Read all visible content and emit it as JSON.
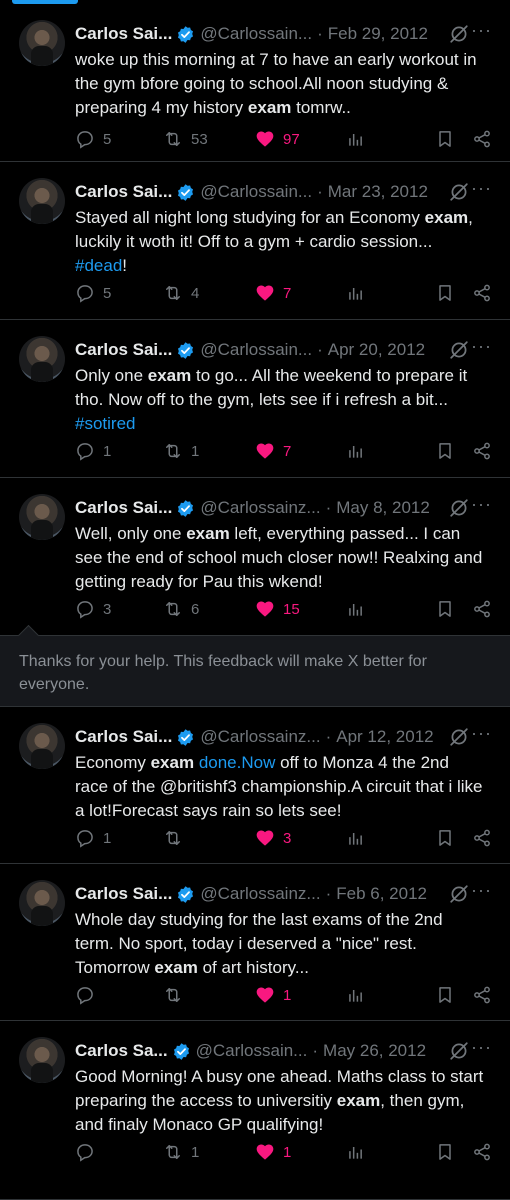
{
  "colors": {
    "accent": "#1d9bf0",
    "like": "#f91880",
    "muted": "#71767b",
    "background": "#000000"
  },
  "tweets": [
    {
      "name": "Carlos Sai...",
      "handle": "@Carlossain...",
      "date": "Feb 29, 2012",
      "text": [
        {
          "t": "woke up this morning at 7 to have an early workout in the gym bfore going to school.All noon studying & preparing  4 my history "
        },
        {
          "t": "exam",
          "s": "b"
        },
        {
          "t": " tomrw.."
        }
      ],
      "replies": "5",
      "retweets": "53",
      "likes": "97",
      "liked": true
    },
    {
      "name": "Carlos Sai...",
      "handle": "@Carlossain...",
      "date": "Mar 23, 2012",
      "text": [
        {
          "t": "Stayed all night long studying for an Economy "
        },
        {
          "t": "exam",
          "s": "b"
        },
        {
          "t": ", luckily it woth it! Off to a gym + cardio session... "
        },
        {
          "t": "#dead",
          "s": "link"
        },
        {
          "t": "!"
        }
      ],
      "replies": "5",
      "retweets": "4",
      "likes": "7",
      "liked": true
    },
    {
      "name": "Carlos Sai...",
      "handle": "@Carlossain...",
      "date": "Apr 20, 2012",
      "text": [
        {
          "t": "Only one "
        },
        {
          "t": "exam",
          "s": "b"
        },
        {
          "t": " to go... All the weekend to prepare it tho. Now off to the gym, lets see if i refresh a bit... "
        },
        {
          "t": "#sotired",
          "s": "link"
        }
      ],
      "replies": "1",
      "retweets": "1",
      "likes": "7",
      "liked": true
    },
    {
      "name": "Carlos Sai...",
      "handle": "@Carlossainz...",
      "date": "May 8, 2012",
      "text": [
        {
          "t": "Well, only one "
        },
        {
          "t": "exam",
          "s": "b"
        },
        {
          "t": " left, everything passed... I can see the end of school much closer now!! Realxing and getting ready for Pau this wkend!"
        }
      ],
      "replies": "3",
      "retweets": "6",
      "likes": "15",
      "liked": true
    },
    {
      "name": "Carlos Sai...",
      "handle": "@Carlossainz...",
      "date": "Apr 12, 2012",
      "text": [
        {
          "t": "Economy "
        },
        {
          "t": "exam",
          "s": "b"
        },
        {
          "t": " "
        },
        {
          "t": "done.Now",
          "s": "link"
        },
        {
          "t": " off to Monza 4 the 2nd race of the @britishf3 championship.A circuit that i like a lot!Forecast says rain so lets see!"
        }
      ],
      "replies": "1",
      "retweets": "",
      "likes": "3",
      "liked": true
    },
    {
      "name": "Carlos Sai...",
      "handle": "@Carlossainz...",
      "date": "Feb 6, 2012",
      "text": [
        {
          "t": "Whole day studying for the last exams of the 2nd term. No sport, today i deserved a \"nice\" rest. Tomorrow "
        },
        {
          "t": "exam",
          "s": "b"
        },
        {
          "t": " of art history..."
        }
      ],
      "replies": "",
      "retweets": "",
      "likes": "1",
      "liked": true
    },
    {
      "name": "Carlos Sa...",
      "handle": "@Carlossain...",
      "date": "May 26, 2012",
      "text": [
        {
          "t": "Good Morning! A busy one ahead. Maths class to start preparing the access to universitiy "
        },
        {
          "t": "exam",
          "s": "b"
        },
        {
          "t": ", then gym, and finaly Monaco GP qualifying!"
        }
      ],
      "replies": "",
      "retweets": "1",
      "likes": "1",
      "liked": true
    }
  ],
  "feedback": {
    "message": "Thanks for your help. This feedback will make X better for everyone."
  },
  "icons": {
    "reply": "reply-icon",
    "retweet": "retweet-icon",
    "like": "heart-icon",
    "views": "analytics-icon",
    "bookmark": "bookmark-icon",
    "share": "share-icon",
    "verified": "verified-badge-icon",
    "grok": "grok-icon",
    "more": "more-icon"
  }
}
